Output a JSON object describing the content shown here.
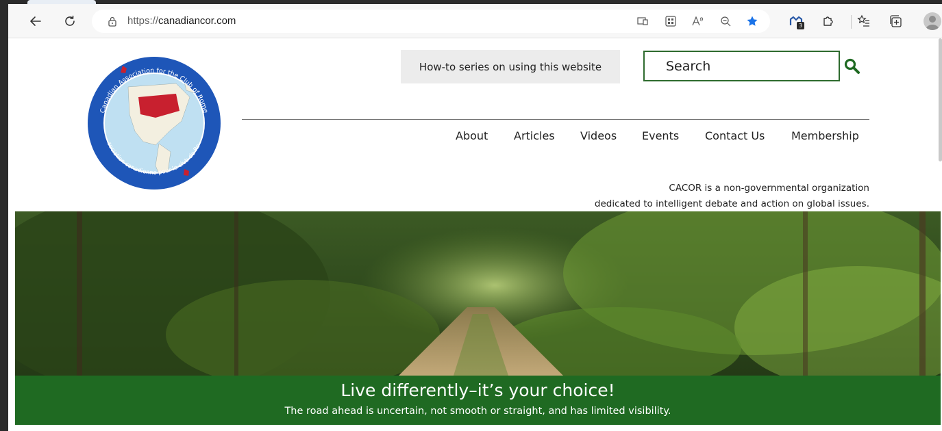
{
  "browser": {
    "url_scheme": "https://",
    "url_host": "canadiancor.com",
    "favorites_badge_count": "3"
  },
  "logo": {
    "outer_text_top": "Canadian Association for the Club of Rome",
    "outer_text_bottom": "Association canadienne pour le club de Rome"
  },
  "header": {
    "howto_label": "How-to series on using this website",
    "search_placeholder": "Search"
  },
  "nav": {
    "items": [
      {
        "label": "About"
      },
      {
        "label": "Articles"
      },
      {
        "label": "Videos"
      },
      {
        "label": "Events"
      },
      {
        "label": "Contact Us"
      },
      {
        "label": "Membership"
      }
    ]
  },
  "tagline": {
    "line1": "CACOR is a non-governmental organization",
    "line2": "dedicated to intelligent debate and action on global issues."
  },
  "hero": {
    "title": "Live differently–it’s your choice!",
    "subtitle": "The road ahead is uncertain, not smooth or straight, and has limited visibility."
  },
  "colors": {
    "brand_green": "#1f6a22",
    "search_border": "#2e6b2e",
    "logo_ring": "#1e56b8",
    "canada_red": "#c8202f",
    "favorite_star": "#1a73e8"
  }
}
